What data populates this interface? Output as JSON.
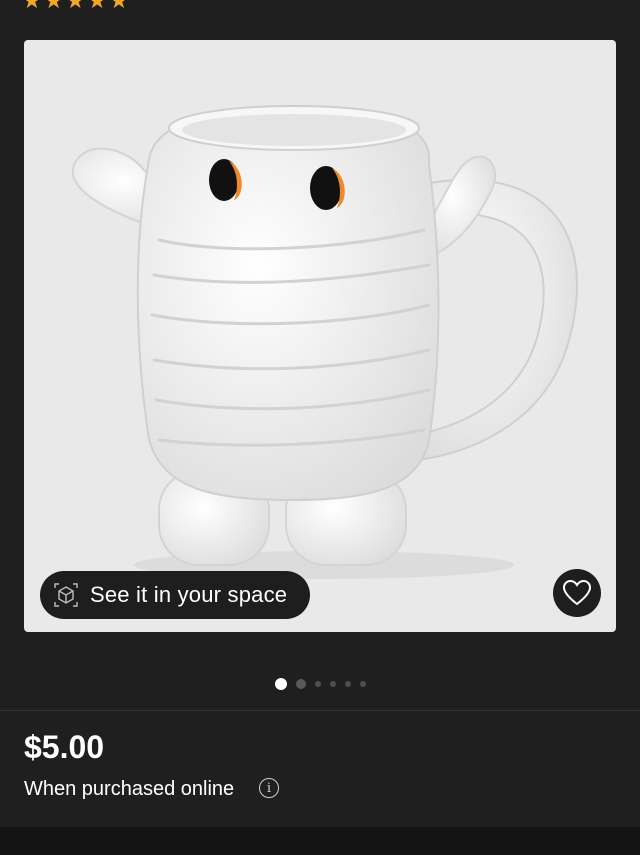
{
  "rating": {
    "stars": 5
  },
  "product_image": {
    "ar_button": {
      "label": "See it in your space",
      "icon": "ar-cube-icon"
    },
    "favorite_button": {
      "icon": "heart-outline-icon"
    },
    "carousel": {
      "total": 6,
      "active_index": 1
    }
  },
  "pricing": {
    "price": "$5.00",
    "note": "When purchased online",
    "info_icon": "info-icon"
  },
  "colors": {
    "background": "#1f1f1f",
    "card": "#e9e9e9",
    "star": "#f5a623",
    "eye_accent": "#f0892a"
  }
}
